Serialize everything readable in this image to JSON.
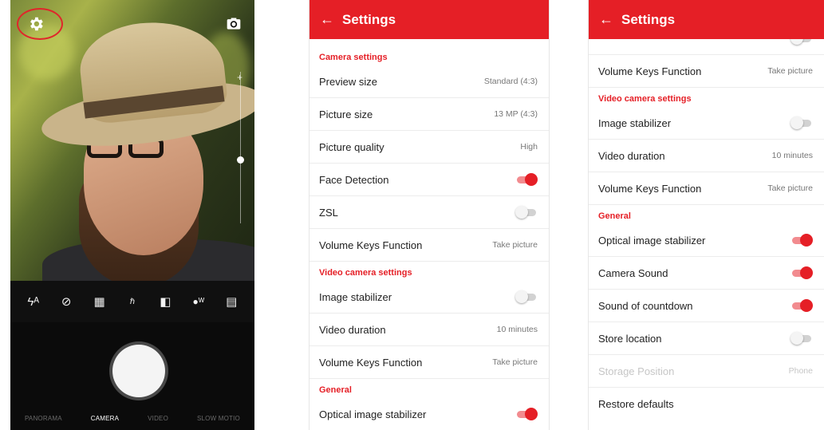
{
  "camera": {
    "bottom_modes": [
      "PANORAMA",
      "CAMERA",
      "VIDEO",
      "SLOW MOTIO"
    ],
    "active_mode": "CAMERA",
    "toolbar_icons": [
      "flash-auto-icon",
      "timer-off-icon",
      "grid-icon",
      "hdr-off-icon",
      "filter-icon",
      "white-balance-auto-icon",
      "more-icon"
    ]
  },
  "settings_left": {
    "title": "Settings",
    "sections": {
      "camera": "Camera settings",
      "video": "Video camera settings",
      "general": "General"
    },
    "rows": {
      "preview_size": {
        "label": "Preview size",
        "value": "Standard (4:3)"
      },
      "picture_size": {
        "label": "Picture size",
        "value": "13 MP (4:3)"
      },
      "picture_quality": {
        "label": "Picture quality",
        "value": "High"
      },
      "face_detection": {
        "label": "Face Detection",
        "toggle": true
      },
      "zsl": {
        "label": "ZSL",
        "toggle": false
      },
      "volume_keys": {
        "label": "Volume Keys Function",
        "value": "Take picture"
      },
      "image_stabilizer": {
        "label": "Image stabilizer",
        "toggle": false
      },
      "video_duration": {
        "label": "Video duration",
        "value": "10 minutes"
      },
      "video_volume_keys": {
        "label": "Volume Keys Function",
        "value": "Take picture"
      },
      "optical_stabilizer": {
        "label": "Optical image stabilizer",
        "toggle": true
      }
    }
  },
  "settings_right": {
    "title": "Settings",
    "sections": {
      "video": "Video camera settings",
      "general": "General"
    },
    "rows": {
      "volume_keys": {
        "label": "Volume Keys Function",
        "value": "Take picture"
      },
      "image_stabilizer": {
        "label": "Image stabilizer",
        "toggle": false
      },
      "video_duration": {
        "label": "Video duration",
        "value": "10 minutes"
      },
      "video_volume_keys": {
        "label": "Volume Keys Function",
        "value": "Take picture"
      },
      "optical_stabilizer": {
        "label": "Optical image stabilizer",
        "toggle": true
      },
      "camera_sound": {
        "label": "Camera Sound",
        "toggle": true
      },
      "countdown_sound": {
        "label": "Sound of countdown",
        "toggle": true
      },
      "store_location": {
        "label": "Store location",
        "toggle": false
      },
      "storage_position": {
        "label": "Storage Position",
        "value": "Phone"
      },
      "restore_defaults": {
        "label": "Restore defaults"
      }
    }
  },
  "colors": {
    "accent": "#e51f26",
    "toggle_track_on": "#f28b8f"
  }
}
